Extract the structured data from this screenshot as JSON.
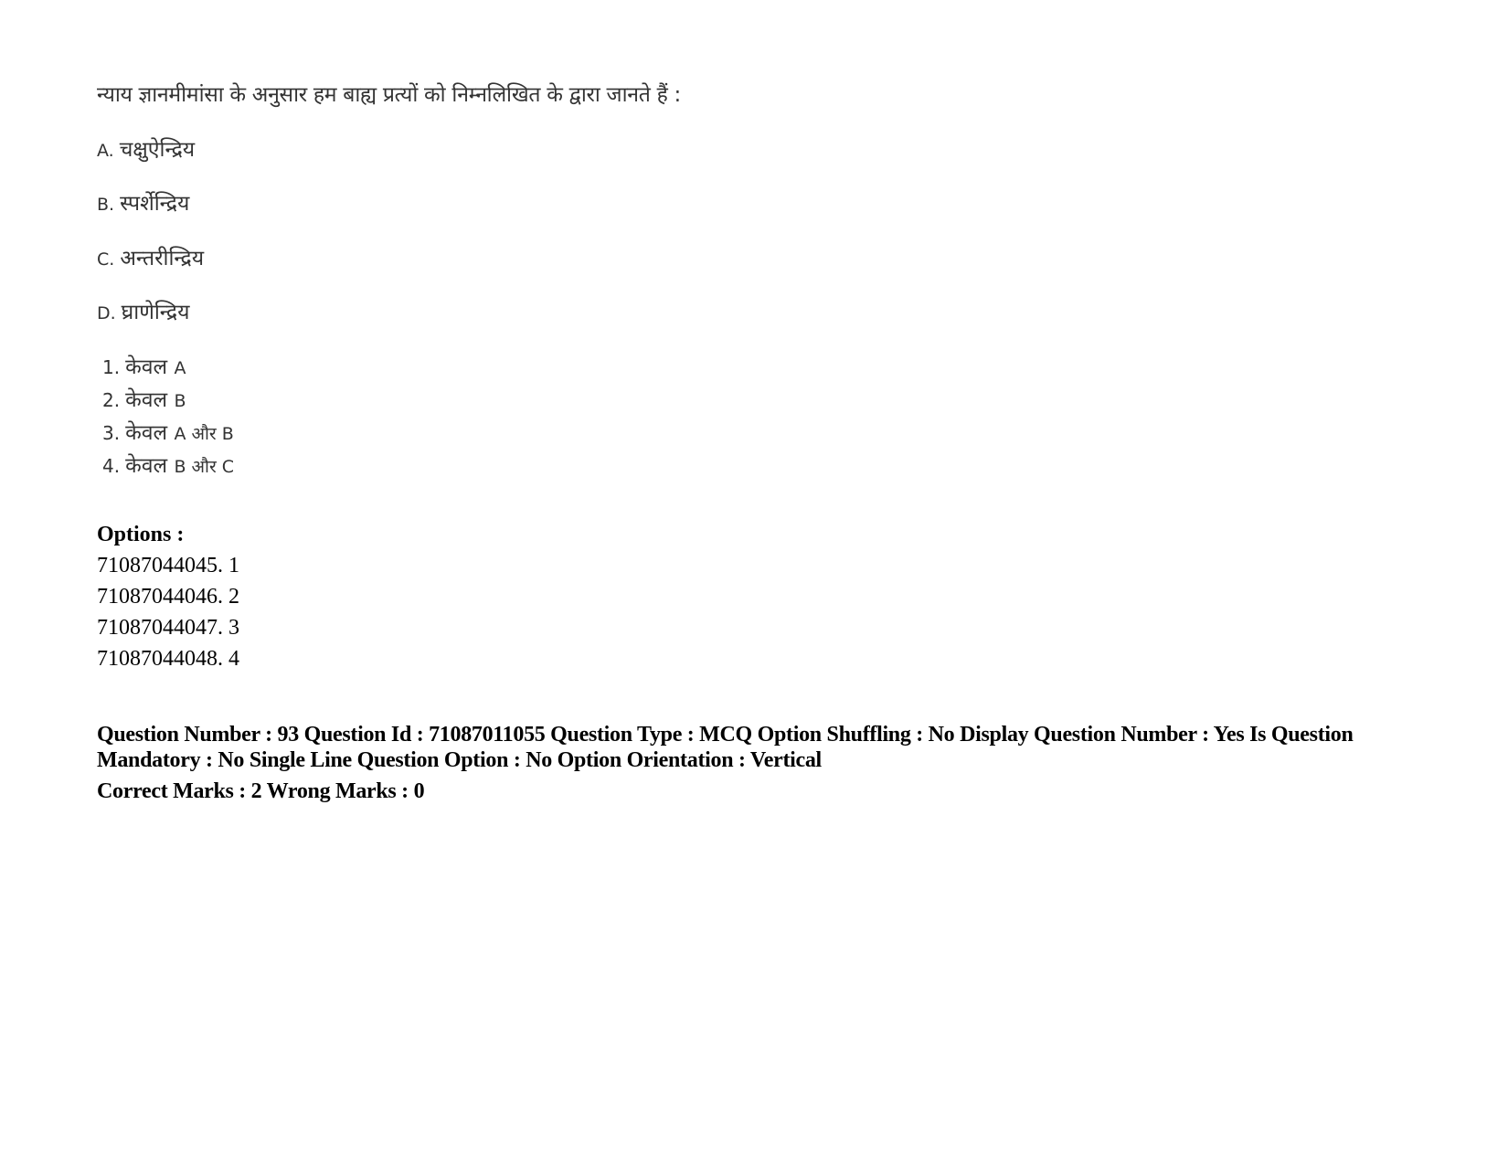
{
  "question": {
    "text": "न्याय ज्ञानमीमांसा के अनुसार हम बाह्य प्रत्यों को निम्नलिखित के द्वारा जानते हैं :",
    "statements": [
      {
        "label": "A.",
        "text": "चक्षुऐन्द्रिय"
      },
      {
        "label": "B.",
        "text": "स्पर्शेन्द्रिय"
      },
      {
        "label": "C.",
        "text": "अन्तरीन्द्रिय"
      },
      {
        "label": "D.",
        "text": "घ्राणेन्द्रिय"
      }
    ],
    "choices": [
      {
        "num": "1.",
        "text": "केवल",
        "latin": "A"
      },
      {
        "num": "2.",
        "text": "केवल",
        "latin": "B"
      },
      {
        "num": "3.",
        "text": "केवल",
        "latin": "A और B"
      },
      {
        "num": "4.",
        "text": "केवल",
        "latin": "B और C"
      }
    ]
  },
  "options": {
    "heading": "Options :",
    "items": [
      "71087044045. 1",
      "71087044046. 2",
      "71087044047. 3",
      "71087044048. 4"
    ]
  },
  "next_question": {
    "meta_line": "Question Number : 93 Question Id : 71087011055 Question Type : MCQ Option Shuffling : No Display Question Number : Yes Is Question Mandatory : No Single Line Question Option : No Option Orientation : Vertical",
    "marks_line": "Correct Marks : 2 Wrong Marks : 0"
  }
}
